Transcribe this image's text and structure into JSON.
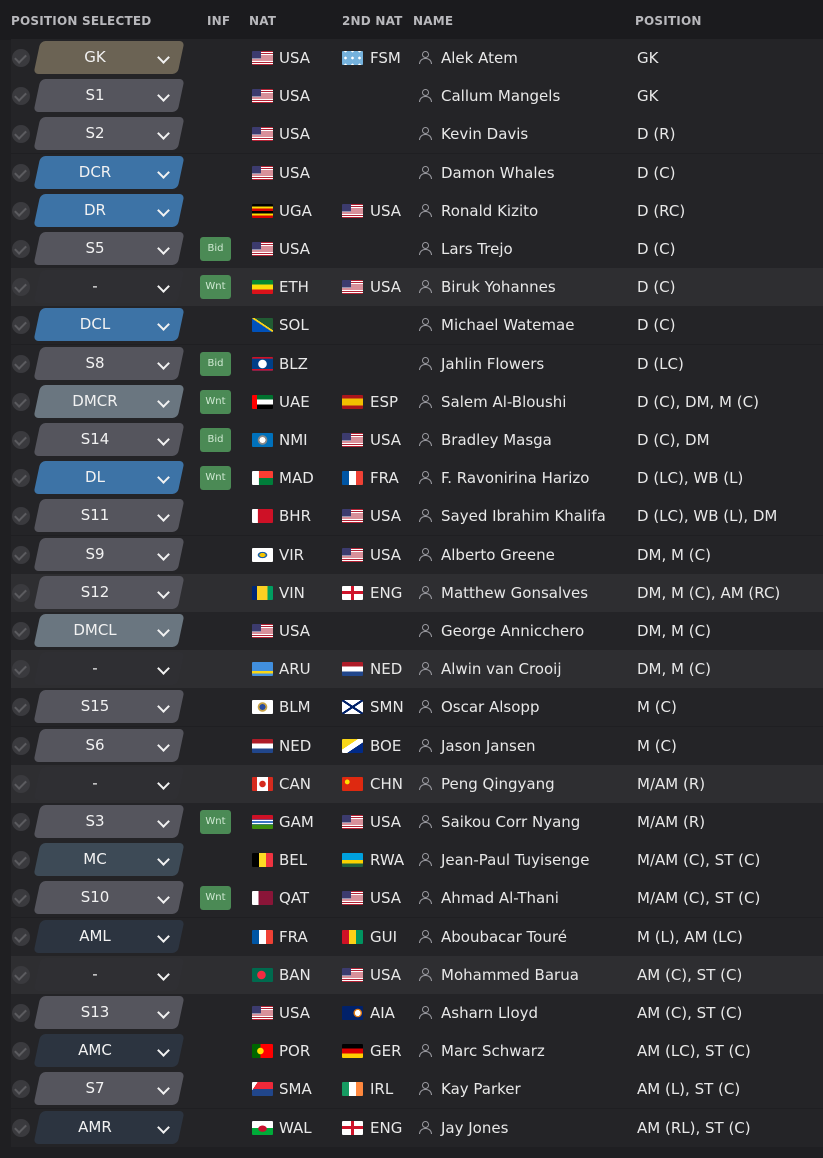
{
  "header": {
    "position_selected": "POSITION SELECTED",
    "inf": "INF",
    "nat": "NAT",
    "second_nat": "2ND NAT",
    "name": "NAME",
    "position": "POSITION"
  },
  "colors": {
    "gk": "#6b6354",
    "sub": "#55555d",
    "blue": "#3d73a6",
    "grey_blue": "#6a7680",
    "dark_slate": "#3d4a56",
    "navy": "#2c3440",
    "none": "#2f2f33",
    "inf_badge": "#4b8a55"
  },
  "rows": [
    {
      "sel": "GK",
      "style": "gk",
      "inf": "",
      "nat": "USA",
      "flag1": "usa",
      "nat2": "FSM",
      "flag2": "fsm",
      "name": "Alek Atem",
      "position": "GK",
      "alt": false
    },
    {
      "sel": "S1",
      "style": "sub",
      "inf": "",
      "nat": "USA",
      "flag1": "usa",
      "nat2": "",
      "flag2": "",
      "name": "Callum Mangels",
      "position": "GK",
      "alt": false
    },
    {
      "sel": "S2",
      "style": "sub",
      "inf": "",
      "nat": "USA",
      "flag1": "usa",
      "nat2": "",
      "flag2": "",
      "name": "Kevin Davis",
      "position": "D (R)",
      "alt": false
    },
    {
      "sel": "DCR",
      "style": "blue",
      "inf": "",
      "nat": "USA",
      "flag1": "usa",
      "nat2": "",
      "flag2": "",
      "name": "Damon Whales",
      "position": "D (C)",
      "alt": false
    },
    {
      "sel": "DR",
      "style": "blue",
      "inf": "",
      "nat": "UGA",
      "flag1": "uga",
      "nat2": "USA",
      "flag2": "usa",
      "name": "Ronald Kizito",
      "position": "D (RC)",
      "alt": false
    },
    {
      "sel": "S5",
      "style": "sub",
      "inf": "Bid",
      "nat": "USA",
      "flag1": "usa",
      "nat2": "",
      "flag2": "",
      "name": "Lars Trejo",
      "position": "D (C)",
      "alt": false
    },
    {
      "sel": "-",
      "style": "none",
      "inf": "Wnt",
      "nat": "ETH",
      "flag1": "eth",
      "nat2": "USA",
      "flag2": "usa",
      "name": "Biruk Yohannes",
      "position": "D (C)",
      "alt": true
    },
    {
      "sel": "DCL",
      "style": "blue",
      "inf": "",
      "nat": "SOL",
      "flag1": "sol",
      "nat2": "",
      "flag2": "",
      "name": "Michael Watemae",
      "position": "D (C)",
      "alt": false
    },
    {
      "sel": "S8",
      "style": "sub",
      "inf": "Bid",
      "nat": "BLZ",
      "flag1": "blz",
      "nat2": "",
      "flag2": "",
      "name": "Jahlin Flowers",
      "position": "D (LC)",
      "alt": false
    },
    {
      "sel": "DMCR",
      "style": "grey_blue",
      "inf": "Wnt",
      "nat": "UAE",
      "flag1": "uae",
      "nat2": "ESP",
      "flag2": "esp",
      "name": "Salem Al-Bloushi",
      "position": "D (C), DM, M (C)",
      "alt": false
    },
    {
      "sel": "S14",
      "style": "sub",
      "inf": "Bid",
      "nat": "NMI",
      "flag1": "nmi",
      "nat2": "USA",
      "flag2": "usa",
      "name": "Bradley Masga",
      "position": "D (C), DM",
      "alt": false
    },
    {
      "sel": "DL",
      "style": "blue",
      "inf": "Wnt",
      "nat": "MAD",
      "flag1": "mad",
      "nat2": "FRA",
      "flag2": "fra",
      "name": "F. Ravonirina Harizo",
      "position": "D (LC), WB (L)",
      "alt": false
    },
    {
      "sel": "S11",
      "style": "sub",
      "inf": "",
      "nat": "BHR",
      "flag1": "bhr",
      "nat2": "USA",
      "flag2": "usa",
      "name": "Sayed Ibrahim Khalifa",
      "position": "D (LC), WB (L), DM",
      "alt": false
    },
    {
      "sel": "S9",
      "style": "sub",
      "inf": "",
      "nat": "VIR",
      "flag1": "vir",
      "nat2": "USA",
      "flag2": "usa",
      "name": "Alberto Greene",
      "position": "DM, M (C)",
      "alt": false
    },
    {
      "sel": "S12",
      "style": "sub",
      "inf": "",
      "nat": "VIN",
      "flag1": "vin",
      "nat2": "ENG",
      "flag2": "eng",
      "name": "Matthew Gonsalves",
      "position": "DM, M (C), AM (RC)",
      "alt": true
    },
    {
      "sel": "DMCL",
      "style": "grey_blue",
      "inf": "",
      "nat": "USA",
      "flag1": "usa",
      "nat2": "",
      "flag2": "",
      "name": "George Annicchero",
      "position": "DM, M (C)",
      "alt": false
    },
    {
      "sel": "-",
      "style": "none",
      "inf": "",
      "nat": "ARU",
      "flag1": "aru",
      "nat2": "NED",
      "flag2": "ned",
      "name": "Alwin van Crooij",
      "position": "DM, M (C)",
      "alt": true
    },
    {
      "sel": "S15",
      "style": "sub",
      "inf": "",
      "nat": "BLM",
      "flag1": "blm",
      "nat2": "SMN",
      "flag2": "smn",
      "name": "Oscar Alsopp",
      "position": "M (C)",
      "alt": false
    },
    {
      "sel": "S6",
      "style": "sub",
      "inf": "",
      "nat": "NED",
      "flag1": "ned",
      "nat2": "BOE",
      "flag2": "boe",
      "name": "Jason Jansen",
      "position": "M (C)",
      "alt": false
    },
    {
      "sel": "-",
      "style": "none",
      "inf": "",
      "nat": "CAN",
      "flag1": "can",
      "nat2": "CHN",
      "flag2": "chn",
      "name": "Peng Qingyang",
      "position": "M/AM (R)",
      "alt": true
    },
    {
      "sel": "S3",
      "style": "sub",
      "inf": "Wnt",
      "nat": "GAM",
      "flag1": "gam",
      "nat2": "USA",
      "flag2": "usa",
      "name": "Saikou Corr Nyang",
      "position": "M/AM (R)",
      "alt": false
    },
    {
      "sel": "MC",
      "style": "dark_slate",
      "inf": "",
      "nat": "BEL",
      "flag1": "bel",
      "nat2": "RWA",
      "flag2": "rwa",
      "name": "Jean-Paul Tuyisenge",
      "position": "M/AM (C), ST (C)",
      "alt": false
    },
    {
      "sel": "S10",
      "style": "sub",
      "inf": "Wnt",
      "nat": "QAT",
      "flag1": "qat",
      "nat2": "USA",
      "flag2": "usa",
      "name": "Ahmad Al-Thani",
      "position": "M/AM (C), ST (C)",
      "alt": false
    },
    {
      "sel": "AML",
      "style": "navy",
      "inf": "",
      "nat": "FRA",
      "flag1": "fra",
      "nat2": "GUI",
      "flag2": "gui",
      "name": "Aboubacar Touré",
      "position": "M (L), AM (LC)",
      "alt": false
    },
    {
      "sel": "-",
      "style": "none",
      "inf": "",
      "nat": "BAN",
      "flag1": "ban",
      "nat2": "USA",
      "flag2": "usa",
      "name": "Mohammed Barua",
      "position": "AM (C), ST (C)",
      "alt": true
    },
    {
      "sel": "S13",
      "style": "sub",
      "inf": "",
      "nat": "USA",
      "flag1": "usa",
      "nat2": "AIA",
      "flag2": "aia",
      "name": "Asharn Lloyd",
      "position": "AM (C), ST (C)",
      "alt": false
    },
    {
      "sel": "AMC",
      "style": "navy",
      "inf": "",
      "nat": "POR",
      "flag1": "por",
      "nat2": "GER",
      "flag2": "ger",
      "name": "Marc Schwarz",
      "position": "AM (LC), ST (C)",
      "alt": false
    },
    {
      "sel": "S7",
      "style": "sub",
      "inf": "",
      "nat": "SMA",
      "flag1": "sma",
      "nat2": "IRL",
      "flag2": "irl",
      "name": "Kay Parker",
      "position": "AM (L), ST (C)",
      "alt": false
    },
    {
      "sel": "AMR",
      "style": "navy",
      "inf": "",
      "nat": "WAL",
      "flag1": "wal",
      "nat2": "ENG",
      "flag2": "eng",
      "name": "Jay Jones",
      "position": "AM (RL), ST (C)",
      "alt": false
    }
  ]
}
